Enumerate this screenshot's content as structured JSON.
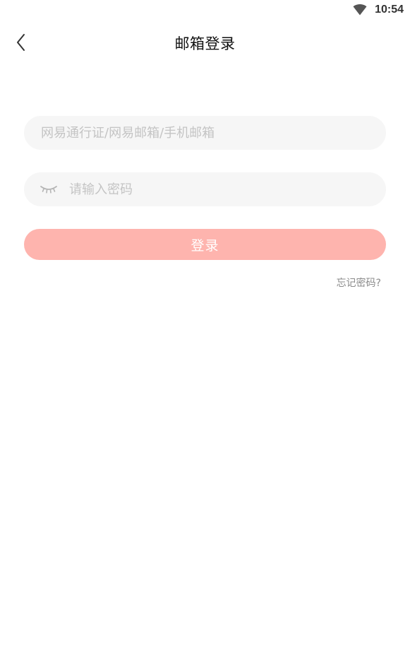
{
  "status_bar": {
    "time": "10:54",
    "wifi_icon": "wifi-icon"
  },
  "header": {
    "title": "邮箱登录",
    "back_icon": "chevron-left-icon"
  },
  "form": {
    "account_placeholder": "网易通行证/网易邮箱/手机邮箱",
    "account_value": "",
    "password_placeholder": "请输入密码",
    "password_value": "",
    "password_toggle_icon": "eye-closed-icon",
    "login_label": "登录",
    "forgot_label": "忘记密码?"
  },
  "colors": {
    "login_button": "#feb4ae",
    "input_background": "#f6f6f6",
    "placeholder": "#c4c4c4"
  }
}
